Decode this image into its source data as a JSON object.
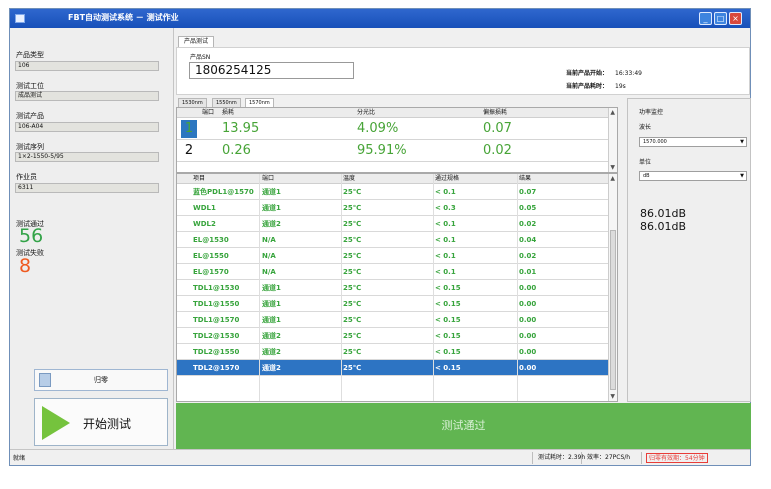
{
  "window": {
    "title": "FBT自动测试系统 － 测试作业"
  },
  "left": {
    "product_type_label": "产品类型",
    "product_type_value": "106",
    "station_label": "测试工位",
    "station_value": "成品测试",
    "product_label": "测试产品",
    "product_value": "106-A04",
    "sequence_label": "测试序列",
    "sequence_value": "1×2-1550-5/95",
    "operator_label": "作业员",
    "operator_value": "6311",
    "pass_label": "测试通过",
    "pass_count": "56",
    "fail_label": "测试失败",
    "fail_count": "8",
    "archive_label": "归零",
    "start_label": "开始测试"
  },
  "main_tab": "产品测试",
  "product": {
    "sn_label": "产品SN",
    "sn_value": "1806254125",
    "start_label": "当前产品开始：",
    "start_value": "16:33:49",
    "elapsed_label": "当前产品耗时：",
    "elapsed_value": "19s"
  },
  "subtabs": [
    "1530nm",
    "1550nm",
    "1570nm"
  ],
  "summary": {
    "headers": [
      "端口",
      "损耗",
      "分光比",
      "偏振损耗"
    ],
    "rows": [
      {
        "port": "1",
        "loss": "13.95",
        "ratio": "4.09%",
        "pdl": "0.07"
      },
      {
        "port": "2",
        "loss": "0.26",
        "ratio": "95.91%",
        "pdl": "0.02"
      }
    ]
  },
  "detail": {
    "headers": [
      "项目",
      "端口",
      "温度",
      "通过规格",
      "结果"
    ],
    "rows": [
      [
        "蓝色PDL1@1570",
        "通道1",
        "25℃",
        "< 0.1",
        "0.07"
      ],
      [
        "WDL1",
        "通道1",
        "25℃",
        "< 0.3",
        "0.05"
      ],
      [
        "WDL2",
        "通道2",
        "25℃",
        "< 0.1",
        "0.02"
      ],
      [
        "EL@1530",
        "N/A",
        "25℃",
        "< 0.1",
        "0.04"
      ],
      [
        "EL@1550",
        "N/A",
        "25℃",
        "< 0.1",
        "0.02"
      ],
      [
        "EL@1570",
        "N/A",
        "25℃",
        "< 0.1",
        "0.01"
      ],
      [
        "TDL1@1530",
        "通道1",
        "25℃",
        "< 0.15",
        "0.00"
      ],
      [
        "TDL1@1550",
        "通道1",
        "25℃",
        "< 0.15",
        "0.00"
      ],
      [
        "TDL1@1570",
        "通道1",
        "25℃",
        "< 0.15",
        "0.00"
      ],
      [
        "TDL2@1530",
        "通道2",
        "25℃",
        "< 0.15",
        "0.00"
      ],
      [
        "TDL2@1550",
        "通道2",
        "25℃",
        "< 0.15",
        "0.00"
      ],
      [
        "TDL2@1570",
        "通道2",
        "25℃",
        "< 0.15",
        "0.00"
      ]
    ]
  },
  "monitor": {
    "title": "功率监控",
    "wavelength_label": "波长",
    "wavelength_value": "1570.000",
    "unit_label": "单位",
    "unit_value": "dB",
    "reading1": "86.01dB",
    "reading2": "86.01dB"
  },
  "pass_message": "测试通过",
  "status": {
    "ready": "就绪",
    "test_time": "测试耗时：2.39h",
    "efficiency": "效率：27PCS/h",
    "archive_warning": "归零有效期：54分钟"
  },
  "icons": {
    "window": "window-icon",
    "archive": "archive-icon",
    "start": "play-icon"
  }
}
